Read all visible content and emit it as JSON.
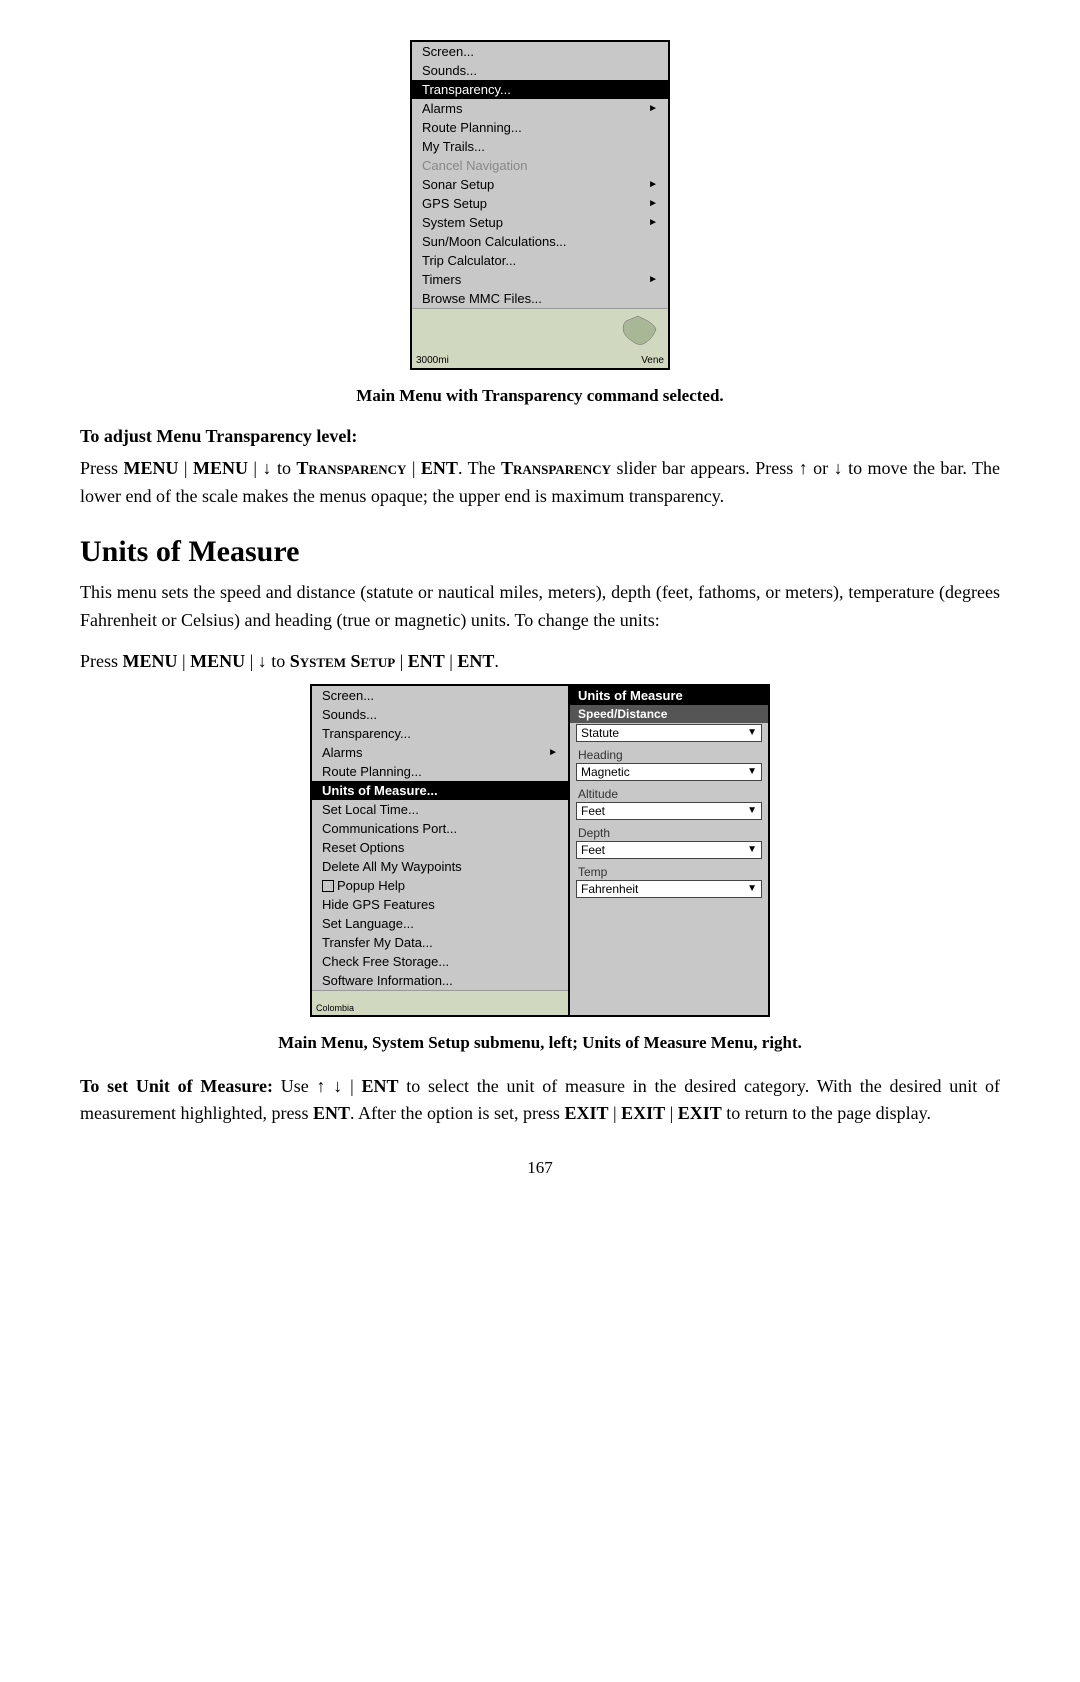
{
  "page": {
    "number": "167"
  },
  "top_menu": {
    "caption": "Main Menu with Transparency command selected.",
    "items": [
      {
        "label": "Screen...",
        "highlighted": false,
        "greyed": false,
        "has_arrow": false
      },
      {
        "label": "Sounds...",
        "highlighted": false,
        "greyed": false,
        "has_arrow": false
      },
      {
        "label": "Transparency...",
        "highlighted": true,
        "greyed": false,
        "has_arrow": false
      },
      {
        "label": "Alarms",
        "highlighted": false,
        "greyed": false,
        "has_arrow": true
      },
      {
        "label": "Route Planning...",
        "highlighted": false,
        "greyed": false,
        "has_arrow": false
      },
      {
        "label": "My Trails...",
        "highlighted": false,
        "greyed": false,
        "has_arrow": false
      },
      {
        "label": "Cancel Navigation",
        "highlighted": false,
        "greyed": true,
        "has_arrow": false
      },
      {
        "label": "Sonar Setup",
        "highlighted": false,
        "greyed": false,
        "has_arrow": true
      },
      {
        "label": "GPS Setup",
        "highlighted": false,
        "greyed": false,
        "has_arrow": true
      },
      {
        "label": "System Setup",
        "highlighted": false,
        "greyed": false,
        "has_arrow": true
      },
      {
        "label": "Sun/Moon Calculations...",
        "highlighted": false,
        "greyed": false,
        "has_arrow": false
      },
      {
        "label": "Trip Calculator...",
        "highlighted": false,
        "greyed": false,
        "has_arrow": false
      },
      {
        "label": "Timers",
        "highlighted": false,
        "greyed": false,
        "has_arrow": true
      },
      {
        "label": "Browse MMC Files...",
        "highlighted": false,
        "greyed": false,
        "has_arrow": false
      }
    ],
    "map_label_left": "3000mi",
    "map_label_right": "Vene"
  },
  "transparency_section": {
    "heading": "To adjust Menu Transparency level:",
    "body": "Press MENU | MENU | ↓ to TRANSPARENCY | ENT. The TRANSPARENCY slider bar appears. Press ↑ or ↓ to move the bar. The lower end of the scale makes the menus opaque; the upper end is maximum transparency."
  },
  "units_section": {
    "title": "Units of Measure",
    "intro": "This menu sets the speed and distance (statute or nautical miles, meters), depth (feet, fathoms, or meters), temperature (degrees Fahrenheit or Celsius) and heading (true or magnetic) units. To change the units:",
    "press_line": "Press MENU | MENU | ↓ to SYSTEM SETUP | ENT | ENT.",
    "bottom_caption": "Main Menu, System Setup submenu, left; Units of Measure Menu, right.",
    "set_unit_text": "To set Unit of Measure: Use ↑ ↓ | ENT to select the unit of measure in the desired category. With the desired unit of measurement highlighted, press ENT. After the option is set, press EXIT | EXIT | EXIT to return to the page display."
  },
  "left_menu": {
    "items": [
      {
        "label": "Screen...",
        "highlighted": false,
        "greyed": false,
        "has_arrow": false
      },
      {
        "label": "Sounds...",
        "highlighted": false,
        "greyed": false,
        "has_arrow": false
      },
      {
        "label": "Transparency...",
        "highlighted": false,
        "greyed": false,
        "has_arrow": false
      },
      {
        "label": "Alarms",
        "highlighted": false,
        "greyed": false,
        "has_arrow": true
      },
      {
        "label": "Route Planning...",
        "highlighted": false,
        "greyed": false,
        "has_arrow": false
      },
      {
        "label": "Units of Measure...",
        "highlighted": true,
        "greyed": false,
        "has_arrow": false
      },
      {
        "label": "Set Local Time...",
        "highlighted": false,
        "greyed": false,
        "has_arrow": false
      },
      {
        "label": "Communications Port...",
        "highlighted": false,
        "greyed": false,
        "has_arrow": false
      },
      {
        "label": "Reset Options",
        "highlighted": false,
        "greyed": false,
        "has_arrow": false
      },
      {
        "label": "Delete All My Waypoints",
        "highlighted": false,
        "greyed": false,
        "has_arrow": false
      },
      {
        "label": "Popup Help",
        "highlighted": false,
        "greyed": false,
        "has_arrow": false,
        "has_checkbox": true
      },
      {
        "label": "Hide GPS Features",
        "highlighted": false,
        "greyed": false,
        "has_arrow": false
      },
      {
        "label": "Set Language...",
        "highlighted": false,
        "greyed": false,
        "has_arrow": false
      },
      {
        "label": "Transfer My Data...",
        "highlighted": false,
        "greyed": false,
        "has_arrow": false
      },
      {
        "label": "Check Free Storage...",
        "highlighted": false,
        "greyed": false,
        "has_arrow": false
      },
      {
        "label": "Software Information...",
        "highlighted": false,
        "greyed": false,
        "has_arrow": false
      }
    ],
    "map_label": "Colombia"
  },
  "right_menu": {
    "header": "Units of Measure",
    "items": [
      {
        "section_label": "Speed/Distance",
        "is_header": true
      },
      {
        "label": "Statute",
        "is_dropdown": true
      },
      {
        "section_label": "Heading",
        "is_label": true
      },
      {
        "label": "Magnetic",
        "is_dropdown": true
      },
      {
        "section_label": "Altitude",
        "is_label": true
      },
      {
        "label": "Feet",
        "is_dropdown": true
      },
      {
        "section_label": "Depth",
        "is_label": true
      },
      {
        "label": "Feet",
        "is_dropdown": true
      },
      {
        "section_label": "Temp",
        "is_label": true
      },
      {
        "label": "Fahrenheit",
        "is_dropdown": true
      }
    ]
  }
}
